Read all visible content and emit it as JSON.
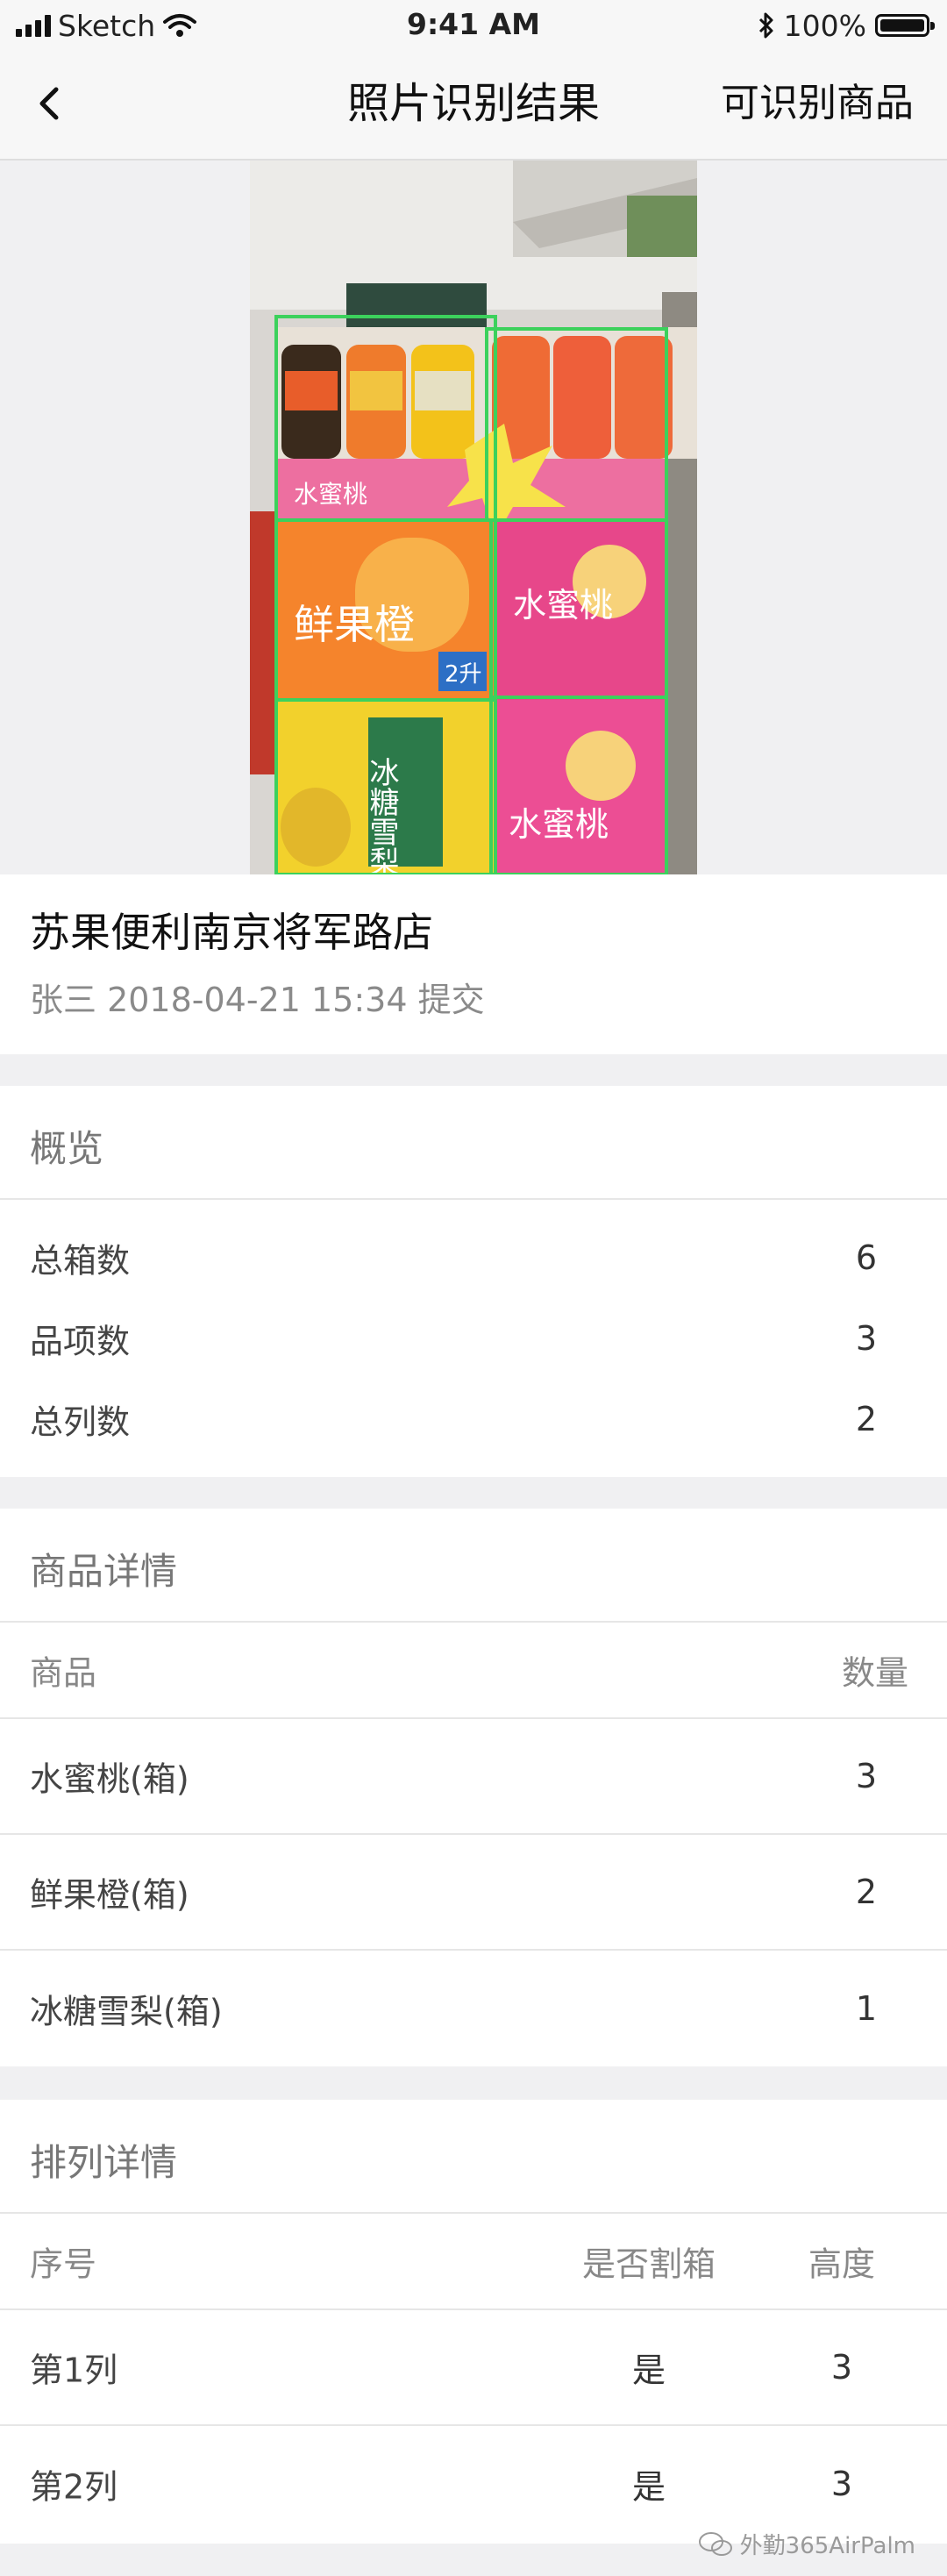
{
  "status_bar": {
    "carrier": "Sketch",
    "time": "9:41 AM",
    "battery": "100%"
  },
  "navbar": {
    "title": "照片识别结果",
    "action_label": "可识别商品"
  },
  "store": {
    "name": "苏果便利南京将军路店",
    "meta": "张三 2018-04-21 15:34 提交"
  },
  "overview": {
    "title": "概览",
    "rows": [
      {
        "label": "总箱数",
        "value": "6"
      },
      {
        "label": "品项数",
        "value": "3"
      },
      {
        "label": "总列数",
        "value": "2"
      }
    ]
  },
  "products": {
    "title": "商品详情",
    "header": {
      "name": "商品",
      "qty": "数量"
    },
    "rows": [
      {
        "name": "水蜜桃(箱)",
        "qty": "3"
      },
      {
        "name": "鲜果橙(箱)",
        "qty": "2"
      },
      {
        "name": "冰糖雪梨(箱)",
        "qty": "1"
      }
    ]
  },
  "columns": {
    "title": "排列详情",
    "header": {
      "index": "序号",
      "split": "是否割箱",
      "height": "高度"
    },
    "rows": [
      {
        "index": "第1列",
        "split": "是",
        "height": "3"
      },
      {
        "index": "第2列",
        "split": "是",
        "height": "3"
      }
    ]
  },
  "photo_labels": {
    "box1": "鲜果橙",
    "box2": "水蜜桃",
    "box3": "水蜜桃",
    "box4": "冰糖雪梨",
    "box5": "水蜜桃",
    "badge": "2升"
  },
  "watermark": "外勤365AirPalm",
  "colors": {
    "detect_box": "#3cd15c",
    "page_bg": "#f0f0f2"
  }
}
